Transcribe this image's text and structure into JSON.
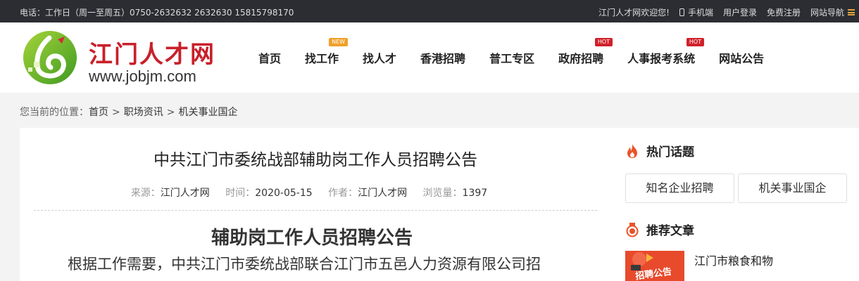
{
  "topbar": {
    "contact": "电话：工作日（周一至周五）0750-2632632 2632630 15815798170",
    "welcome": "江门人才网欢迎您!",
    "mobile": "手机端",
    "login": "用户登录",
    "register": "免费注册",
    "site_nav": "网站导航"
  },
  "logo": {
    "name": "江门人才网",
    "url": "www.jobjm.com"
  },
  "nav": [
    {
      "label": "首页",
      "badge": ""
    },
    {
      "label": "找工作",
      "badge": "NEW"
    },
    {
      "label": "找人才",
      "badge": ""
    },
    {
      "label": "香港招聘",
      "badge": ""
    },
    {
      "label": "普工专区",
      "badge": ""
    },
    {
      "label": "政府招聘",
      "badge": "HOT"
    },
    {
      "label": "人事报考系统",
      "badge": "HOT"
    },
    {
      "label": "网站公告",
      "badge": ""
    }
  ],
  "breadcrumb": {
    "prefix": "您当前的位置：",
    "items": [
      "首页",
      "职场资讯",
      "机关事业国企"
    ]
  },
  "article": {
    "title": "中共江门市委统战部辅助岗工作人员招聘公告",
    "source_label": "来源：",
    "source": "江门人才网",
    "time_label": "时间：",
    "time": "2020-05-15",
    "author_label": "作者：",
    "author": "江门人才网",
    "views_label": "浏览量：",
    "views": "1397",
    "heading": "辅助岗工作人员招聘公告",
    "paragraph": "根据工作需要，中共江门市委统战部联合江门市五邑人力资源有限公司招"
  },
  "sidebar": {
    "hot_title": "热门话题",
    "tags": [
      "知名企业招聘",
      "机关事业国企"
    ],
    "recommend_title": "推荐文章",
    "rec_thumb_text": "招聘公告",
    "rec_item": "江门市粮食和物"
  },
  "colors": {
    "brand_red": "#c8202a",
    "logo_green": "#6cbb2a",
    "topbar_bg": "#2b2d33",
    "accent_orange": "#f0a02a"
  }
}
